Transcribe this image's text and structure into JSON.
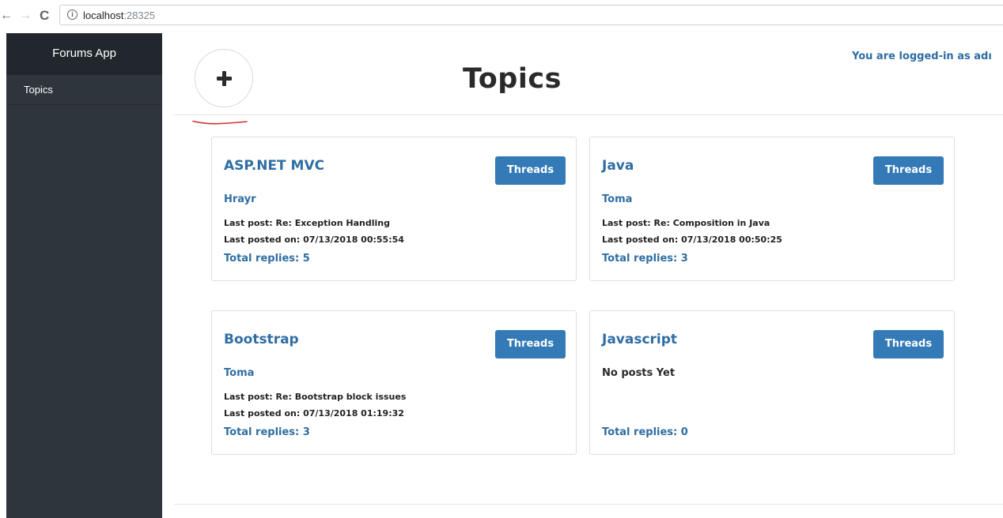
{
  "browser": {
    "url_host": "localhost",
    "url_port": ":28325"
  },
  "sidebar": {
    "brand": "Forums App",
    "items": [
      {
        "label": "Topics"
      }
    ]
  },
  "header": {
    "title": "Topics",
    "login_status": "You are logged-in as adı"
  },
  "topics": [
    {
      "title": "ASP.NET MVC",
      "threads_label": "Threads",
      "author": "Hrayr",
      "last_post": "Last post: Re: Exception Handling",
      "last_posted_on": "Last posted on: 07/13/2018 00:55:54",
      "total_replies": "Total replies: 5"
    },
    {
      "title": "Java",
      "threads_label": "Threads",
      "author": "Toma",
      "last_post": "Last post: Re: Composition in Java",
      "last_posted_on": "Last posted on: 07/13/2018 00:50:25",
      "total_replies": "Total replies: 3"
    },
    {
      "title": "Bootstrap",
      "threads_label": "Threads",
      "author": "Toma",
      "last_post": "Last post: Re: Bootstrap block issues",
      "last_posted_on": "Last posted on: 07/13/2018 01:19:32",
      "total_replies": "Total replies: 3"
    },
    {
      "title": "Javascript",
      "threads_label": "Threads",
      "no_posts": "No posts Yet",
      "total_replies": "Total replies: 0"
    }
  ],
  "colors": {
    "accent": "#337ab7",
    "link": "#2f6da3",
    "sidebar": "#2f353d",
    "sidebar_brand": "#22272d",
    "annotation": "#d32f2f"
  },
  "icons": {
    "back": "back-arrow-icon",
    "forward": "forward-arrow-icon",
    "reload": "reload-icon",
    "info": "info-icon",
    "add": "plus-icon"
  }
}
